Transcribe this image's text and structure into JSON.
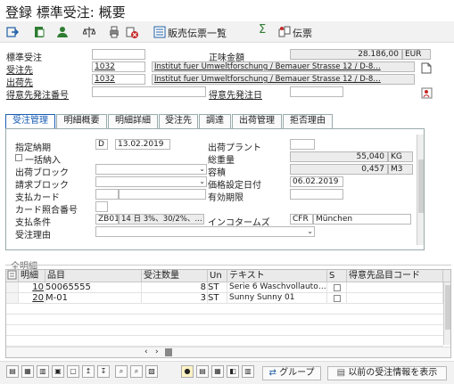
{
  "window": {
    "title": "登録 標準受注: 概要"
  },
  "toolbar": {
    "icons": [
      "enter-icon",
      "display-icon",
      "person-icon",
      "scale-icon",
      "print-icon",
      "delete-icon"
    ],
    "sales_docs_label": "販売伝票一覧",
    "sigma_label": "Σ",
    "document_label": "伝票"
  },
  "header": {
    "standard_order_label": "標準受注",
    "standard_order_value": "",
    "net_value_label": "正味金額",
    "net_value": "28.186,00",
    "currency": "EUR",
    "sold_to_label": "受注先",
    "sold_to_id": "1032",
    "sold_to_name": "Institut fuer Umweltforschung / Bemauer Strasse 12 / D-8…",
    "ship_to_label": "出荷先",
    "ship_to_id": "1032",
    "ship_to_name": "Institut fuer Umweltforschung / Bemauer Strasse 12 / D-8…",
    "customer_po_label": "得意先発注番号",
    "customer_po_value": "",
    "customer_po_date_label": "得意先発注日",
    "customer_po_date_value": ""
  },
  "tabs": [
    {
      "label": "受注管理",
      "active": true
    },
    {
      "label": "明細概要",
      "active": false
    },
    {
      "label": "明細詳細",
      "active": false
    },
    {
      "label": "受注先",
      "active": false
    },
    {
      "label": "調達",
      "active": false
    },
    {
      "label": "出荷管理",
      "active": false
    },
    {
      "label": "拒否理由",
      "active": false
    }
  ],
  "panel": {
    "req_deliv_label": "指定納期",
    "req_deliv_type": "D",
    "req_deliv_date": "13.02.2019",
    "plant_label": "出荷プラント",
    "plant_value": "",
    "complete_label": "一括納入",
    "total_weight_label": "総重量",
    "total_weight": "55,040",
    "weight_unit": "KG",
    "delivery_block_label": "出荷ブロック",
    "delivery_block": "",
    "volume_label": "容積",
    "volume": "0,457",
    "volume_unit": "M3",
    "billing_block_label": "請求ブロック",
    "billing_block": "",
    "pricing_date_label": "価格設定日付",
    "pricing_date": "06.02.2019",
    "payment_card_label": "支払カード",
    "payment_card": "",
    "validity_label": "有効期限",
    "validity": "",
    "card_verif_label": "カード照合番号",
    "card_verif": "",
    "payment_terms_label": "支払条件",
    "payment_terms_code": "ZB01",
    "payment_terms_text": "14 日 3%、30/2%、…",
    "incoterms_label": "インコタームズ",
    "incoterms_code": "CFR",
    "incoterms_place": "München",
    "order_reason_label": "受注理由",
    "order_reason": ""
  },
  "items": {
    "section_label": "全明細",
    "columns": [
      "明細",
      "品目",
      "受注数量",
      "Un",
      "テキスト",
      "S",
      "得意先品目コード"
    ],
    "rows": [
      {
        "item": "10",
        "material": "50065555",
        "qty": "8",
        "unit": "ST",
        "text": "Serie 6 Waschvollauto…"
      },
      {
        "item": "20",
        "material": "M-01",
        "qty": "3",
        "unit": "ST",
        "text": "Sunny Sunny 01"
      }
    ]
  },
  "bottom": {
    "group_label": "グループ",
    "prev_order_label": "以前の受注情報を表示"
  },
  "colors": {
    "accent": "#1a5fb4",
    "readonly": "#ececec"
  }
}
